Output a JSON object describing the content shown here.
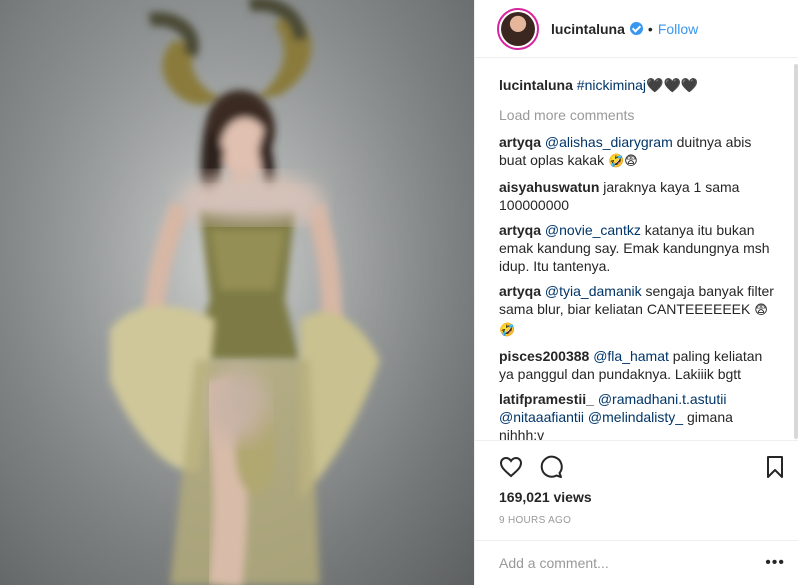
{
  "post": {
    "author": "lucintaluna",
    "follow_label": "Follow",
    "dot": "•",
    "caption_user": "lucintaluna",
    "caption_text": "#nickiminaj🖤🖤🖤",
    "load_more": "Load more comments",
    "likes": "169,021 views",
    "timestamp": "9 HOURS AGO",
    "add_comment_placeholder": "Add a comment...",
    "more_options": "•••"
  },
  "comments": [
    {
      "user": "artyqa",
      "mention": "@alishas_diarygram",
      "text": " duitnya abis buat oplas kakak ",
      "emoji": "🤣😨"
    },
    {
      "user": "aisyahuswatun",
      "mention": "",
      "text": "jaraknya kaya 1 sama 100000000",
      "emoji": ""
    },
    {
      "user": "artyqa",
      "mention": "@novie_cantkz",
      "text": " katanya itu bukan emak kandung say. Emak kandungnya msh idup. Itu tantenya.",
      "emoji": ""
    },
    {
      "user": "artyqa",
      "mention": "@tyia_damanik",
      "text": " sengaja banyak filter sama blur, biar keliatan CANTEEEEEEK ",
      "emoji": "😨🤣"
    },
    {
      "user": "pisces200388",
      "mention": "@fla_hamat",
      "text": " paling keliatan ya panggul dan pundaknya. Lakiiik bgtt",
      "emoji": ""
    },
    {
      "user": "latifpramestii_",
      "mention": "@ramadhani.t.astutii @nitaaafiantii @melindalisty_",
      "text": " gimana nihhh:v",
      "emoji": ""
    }
  ],
  "icons": {
    "like": "heart-icon",
    "comment": "comment-icon",
    "save": "bookmark-icon",
    "verified": "verified-badge-icon"
  },
  "colors": {
    "link_blue": "#3897f0",
    "mention_blue": "#003569",
    "muted_gray": "#999999"
  }
}
